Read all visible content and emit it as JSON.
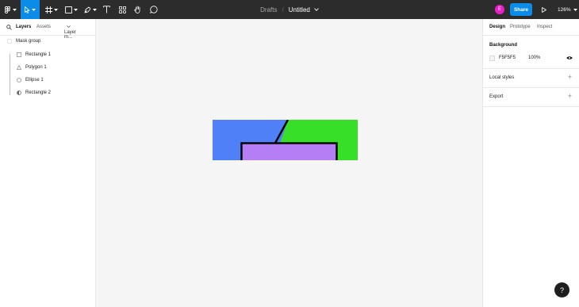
{
  "toolbar": {
    "breadcrumb": "Drafts",
    "separator": "/",
    "file_name": "Untitled",
    "avatar_initial": "E",
    "share_label": "Share",
    "zoom_label": "126%",
    "tools": [
      "main-menu",
      "move",
      "frame",
      "shape",
      "pen",
      "text",
      "resources",
      "hand",
      "comment"
    ],
    "active_tool": "move",
    "accent_color": "#0c8ce9",
    "avatar_color": "#e91ec7"
  },
  "left_panel": {
    "tabs": [
      "Layers",
      "Assets"
    ],
    "page_selector": "Layer m...",
    "layers": [
      {
        "name": "Mask group",
        "icon": "mask-group-icon"
      },
      {
        "name": "Rectangle 1",
        "icon": "rectangle-icon"
      },
      {
        "name": "Polygon 1",
        "icon": "polygon-icon"
      },
      {
        "name": "Ellipse 1",
        "icon": "ellipse-icon"
      },
      {
        "name": "Rectangle 2",
        "icon": "mask-icon"
      }
    ]
  },
  "canvas": {
    "background": "#f5f5f5",
    "shape_colors": {
      "blue": "#4f80f7",
      "green": "#38df28",
      "purple": "#b57ef5",
      "stroke": "#000000"
    }
  },
  "right_panel": {
    "tabs": [
      "Design",
      "Prototype",
      "Inspect"
    ],
    "background_title": "Background",
    "background_hex": "F5F5F5",
    "background_opacity": "100%",
    "local_styles_label": "Local styles",
    "export_label": "Export"
  },
  "help_label": "?"
}
